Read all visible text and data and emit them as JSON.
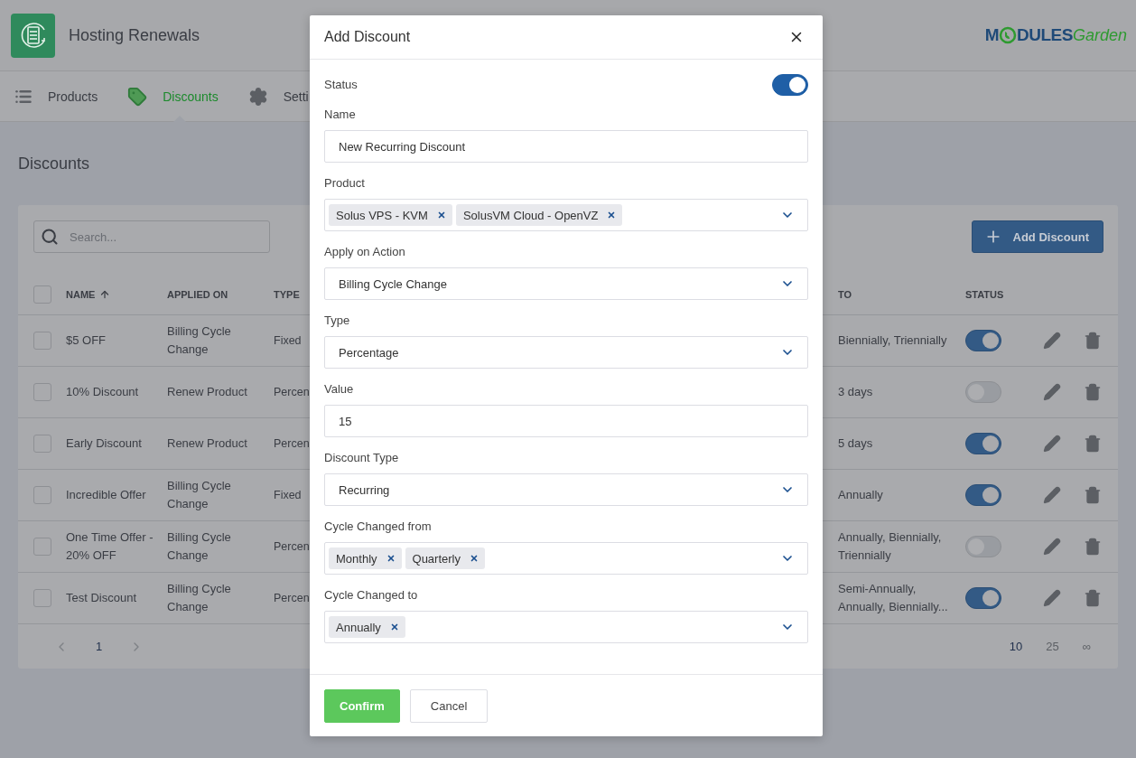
{
  "app": {
    "title": "Hosting Renewals",
    "logo": {
      "lead": "M",
      "rest": "DULES",
      "script": "Garden"
    }
  },
  "tabs": [
    {
      "label": "Products",
      "selected": false
    },
    {
      "label": "Discounts",
      "selected": true
    },
    {
      "label": "Setti",
      "selected": false
    }
  ],
  "page": {
    "heading": "Discounts",
    "search": {
      "placeholder": "Search..."
    },
    "add_button": "Add Discount"
  },
  "table": {
    "select_all_checked": false,
    "columns": {
      "name": "NAME",
      "applied_on": "APPLIED ON",
      "type": "TYPE",
      "to": "TO",
      "status": "STATUS"
    },
    "rows": [
      {
        "checked": false,
        "name": "$5 OFF",
        "applied_on": "Billing Cycle Change",
        "type": "Fixed",
        "to": "Biennially, Triennially",
        "on": true
      },
      {
        "checked": false,
        "name": "10% Discount",
        "applied_on": "Renew Product",
        "type": "Percen",
        "to": "3 days",
        "on": false
      },
      {
        "checked": false,
        "name": "Early Discount",
        "applied_on": "Renew Product",
        "type": "Percen",
        "to": "5 days",
        "on": true
      },
      {
        "checked": false,
        "name": "Incredible Offer",
        "applied_on": "Billing Cycle Change",
        "type": "Fixed",
        "to": "Annually",
        "on": true
      },
      {
        "checked": false,
        "name": "One Time Offer - 20% OFF",
        "applied_on": "Billing Cycle Change",
        "type": "Percen",
        "to": "Annually, Biennially, Triennially",
        "on": false
      },
      {
        "checked": false,
        "name": "Test Discount",
        "applied_on": "Billing Cycle Change",
        "type": "Percen",
        "to": "Semi-Annually, Annually, Biennially...",
        "on": true
      }
    ],
    "pagination": {
      "pages": [
        {
          "label": "1",
          "selected": true
        }
      ],
      "page_sizes": [
        {
          "label": "10",
          "selected": true
        },
        {
          "label": "25",
          "selected": false
        },
        {
          "label": "∞",
          "selected": false
        }
      ]
    }
  },
  "modal": {
    "title": "Add Discount",
    "fields": [
      {
        "kind": "toggle",
        "label": "Status",
        "on": true
      },
      {
        "kind": "text",
        "label": "Name",
        "value": "New Recurring Discount"
      },
      {
        "kind": "multiselect",
        "label": "Product",
        "tags": [
          "Solus VPS - KVM",
          "SolusVM Cloud - OpenVZ"
        ]
      },
      {
        "kind": "select",
        "label": "Apply on Action",
        "value": "Billing Cycle Change"
      },
      {
        "kind": "select",
        "label": "Type",
        "value": "Percentage"
      },
      {
        "kind": "text",
        "label": "Value",
        "value": "15"
      },
      {
        "kind": "select",
        "label": "Discount Type",
        "value": "Recurring"
      },
      {
        "kind": "multiselect",
        "label": "Cycle Changed from",
        "tags": [
          "Monthly",
          "Quarterly"
        ]
      },
      {
        "kind": "multiselect",
        "label": "Cycle Changed to",
        "tags": [
          "Annually"
        ]
      }
    ],
    "buttons": [
      {
        "kind": "primary",
        "label": "Confirm"
      },
      {
        "kind": "secondary",
        "label": "Cancel"
      }
    ]
  }
}
